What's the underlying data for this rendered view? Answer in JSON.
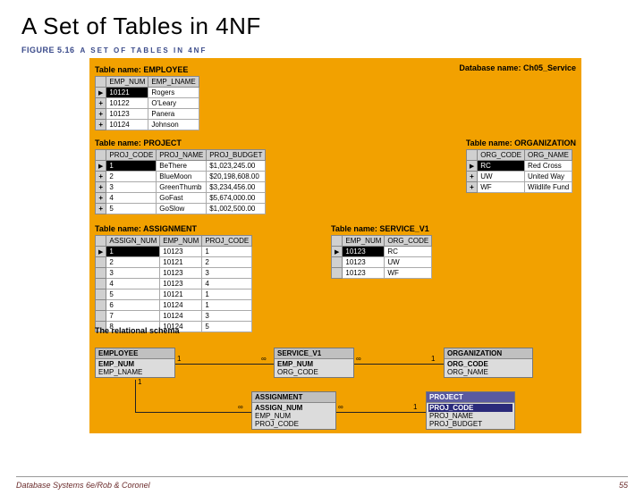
{
  "title": "A Set of Tables in 4NF",
  "figure_label_prefix": "FIGURE 5.16",
  "figure_label_text": "A SET OF TABLES IN 4NF",
  "database_label": "Database name:",
  "database_name": "Ch05_Service",
  "tables": {
    "employee": {
      "label": "Table name: EMPLOYEE",
      "columns": [
        "EMP_NUM",
        "EMP_LNAME"
      ],
      "rows": [
        [
          "10121",
          "Rogers"
        ],
        [
          "10122",
          "O'Leary"
        ],
        [
          "10123",
          "Panera"
        ],
        [
          "10124",
          "Johnson"
        ]
      ]
    },
    "project": {
      "label": "Table name: PROJECT",
      "columns": [
        "PROJ_CODE",
        "PROJ_NAME",
        "PROJ_BUDGET"
      ],
      "rows": [
        [
          "1",
          "BeThere",
          "$1,023,245.00"
        ],
        [
          "2",
          "BlueMoon",
          "$20,198,608.00"
        ],
        [
          "3",
          "GreenThumb",
          "$3,234,456.00"
        ],
        [
          "4",
          "GoFast",
          "$5,674,000.00"
        ],
        [
          "5",
          "GoSlow",
          "$1,002,500.00"
        ]
      ]
    },
    "assignment": {
      "label": "Table name: ASSIGNMENT",
      "columns": [
        "ASSIGN_NUM",
        "EMP_NUM",
        "PROJ_CODE"
      ],
      "rows": [
        [
          "1",
          "10123",
          "1"
        ],
        [
          "2",
          "10121",
          "2"
        ],
        [
          "3",
          "10123",
          "3"
        ],
        [
          "4",
          "10123",
          "4"
        ],
        [
          "5",
          "10121",
          "1"
        ],
        [
          "6",
          "10124",
          "1"
        ],
        [
          "7",
          "10124",
          "3"
        ],
        [
          "8",
          "10124",
          "5"
        ]
      ]
    },
    "organization": {
      "label": "Table name: ORGANIZATION",
      "columns": [
        "ORG_CODE",
        "ORG_NAME"
      ],
      "rows": [
        [
          "RC",
          "Red Cross"
        ],
        [
          "UW",
          "United Way"
        ],
        [
          "WF",
          "Wildlife Fund"
        ]
      ]
    },
    "service_v1": {
      "label": "Table name: SERVICE_V1",
      "columns": [
        "EMP_NUM",
        "ORG_CODE"
      ],
      "rows": [
        [
          "10123",
          "RC"
        ],
        [
          "10123",
          "UW"
        ],
        [
          "10123",
          "WF"
        ]
      ]
    }
  },
  "schema_label": "The relational schema",
  "schema": {
    "employee": {
      "name": "EMPLOYEE",
      "fields": [
        "EMP_NUM",
        "EMP_LNAME"
      ]
    },
    "service_v1": {
      "name": "SERVICE_V1",
      "fields": [
        "EMP_NUM",
        "ORG_CODE"
      ]
    },
    "organization": {
      "name": "ORGANIZATION",
      "fields": [
        "ORG_CODE",
        "ORG_NAME"
      ]
    },
    "assignment": {
      "name": "ASSIGNMENT",
      "fields": [
        "ASSIGN_NUM",
        "EMP_NUM",
        "PROJ_CODE"
      ]
    },
    "project": {
      "name": "PROJECT",
      "fields": [
        "PROJ_CODE",
        "PROJ_NAME",
        "PROJ_BUDGET"
      ]
    }
  },
  "cardinality": {
    "one": "1",
    "many": "∞"
  },
  "footer_left": "Database Systems 6e/Rob & Coronel",
  "footer_right": "55"
}
